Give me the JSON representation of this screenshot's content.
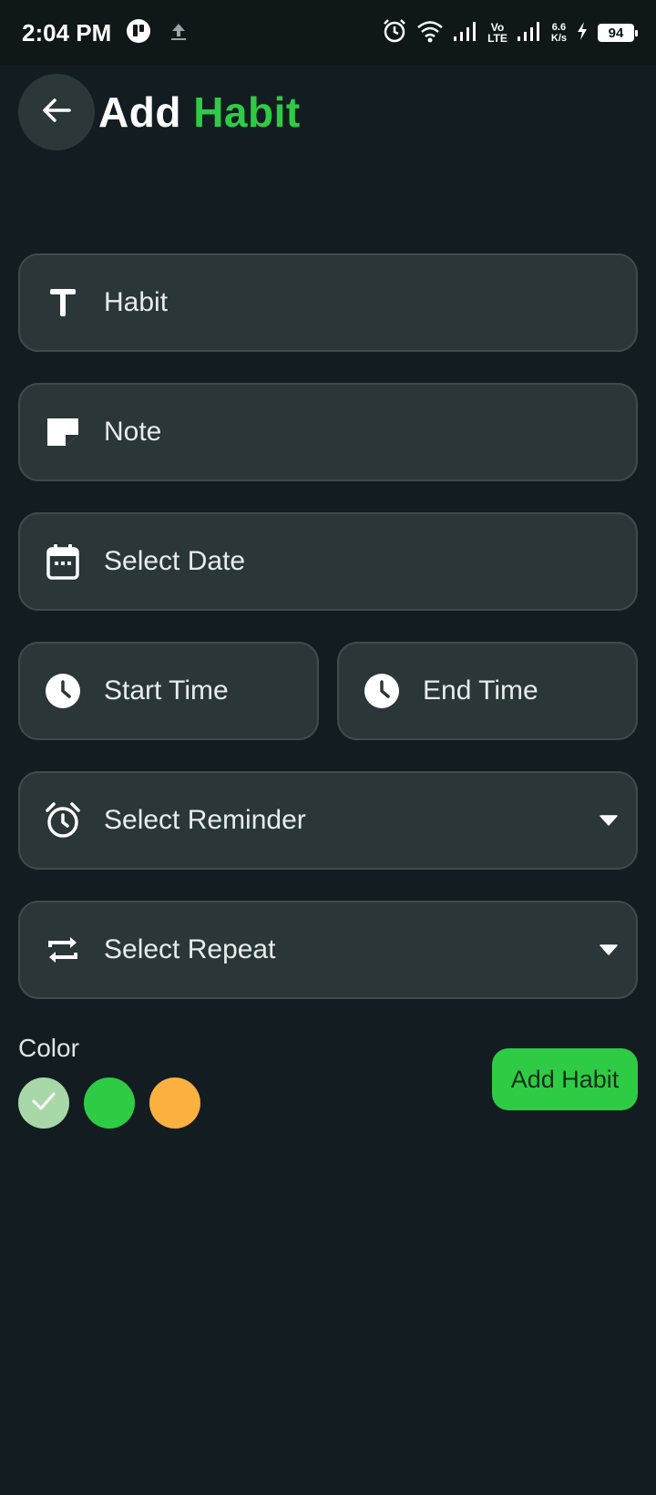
{
  "status_bar": {
    "time": "2:04 PM",
    "volte_top": "Vo",
    "volte_bottom": "LTE",
    "speed_value": "6.6",
    "speed_unit": "K/s",
    "battery": "94"
  },
  "header": {
    "title_plain": "Add",
    "title_accent": "Habit",
    "accent_color": "#2ecc44"
  },
  "form": {
    "habit_placeholder": "Habit",
    "note_placeholder": "Note",
    "date_placeholder": "Select Date",
    "start_time_placeholder": "Start Time",
    "end_time_placeholder": "End Time",
    "reminder_placeholder": "Select Reminder",
    "repeat_placeholder": "Select Repeat"
  },
  "color_picker": {
    "label": "Color",
    "options": [
      {
        "name": "light-green",
        "hex": "#a9d8a8",
        "selected": true
      },
      {
        "name": "green",
        "hex": "#2ecc44",
        "selected": false
      },
      {
        "name": "orange",
        "hex": "#fbb040",
        "selected": false
      }
    ]
  },
  "actions": {
    "add_label": "Add Habit"
  }
}
